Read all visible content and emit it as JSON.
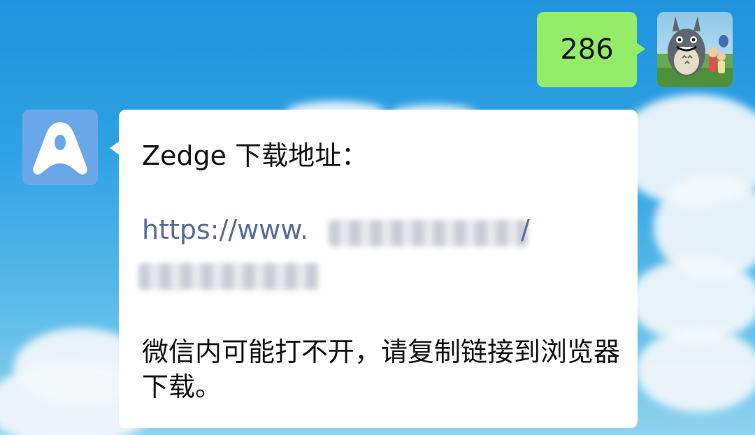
{
  "chat": {
    "sent_message": {
      "text": "286"
    },
    "received_message": {
      "title": "Zedge 下载地址：",
      "link_visible_prefix": "https://www.",
      "link_trailing_char": "/",
      "body": "微信内可能打不开，请复制链接到浏览器下载。"
    }
  }
}
